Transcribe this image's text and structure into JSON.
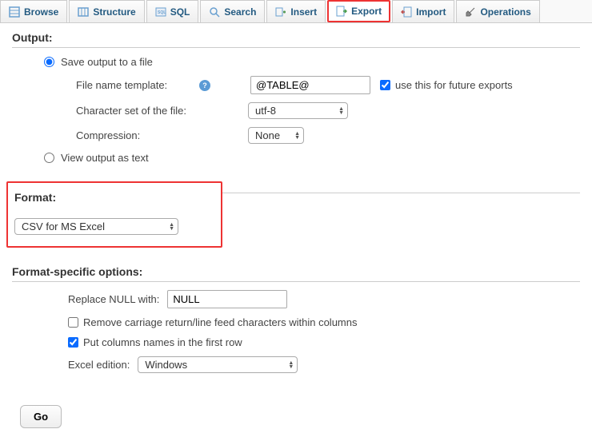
{
  "tabs": [
    {
      "label": "Browse",
      "icon": "browse-icon"
    },
    {
      "label": "Structure",
      "icon": "structure-icon"
    },
    {
      "label": "SQL",
      "icon": "sql-icon"
    },
    {
      "label": "Search",
      "icon": "search-icon"
    },
    {
      "label": "Insert",
      "icon": "insert-icon"
    },
    {
      "label": "Export",
      "icon": "export-icon",
      "highlighted": true
    },
    {
      "label": "Import",
      "icon": "import-icon"
    },
    {
      "label": "Operations",
      "icon": "operations-icon"
    }
  ],
  "output": {
    "heading": "Output:",
    "save_file_label": "Save output to a file",
    "filename_template_label": "File name template:",
    "filename_template_value": "@TABLE@",
    "use_future_label": "use this for future exports",
    "charset_label": "Character set of the file:",
    "charset_value": "utf-8",
    "compression_label": "Compression:",
    "compression_value": "None",
    "view_as_text_label": "View output as text"
  },
  "format": {
    "heading": "Format:",
    "value": "CSV for MS Excel"
  },
  "options": {
    "heading": "Format-specific options:",
    "replace_null_label": "Replace NULL with:",
    "replace_null_value": "NULL",
    "remove_crlf_label": "Remove carriage return/line feed characters within columns",
    "put_columns_label": "Put columns names in the first row",
    "excel_label": "Excel edition:",
    "excel_value": "Windows"
  },
  "go_label": "Go"
}
